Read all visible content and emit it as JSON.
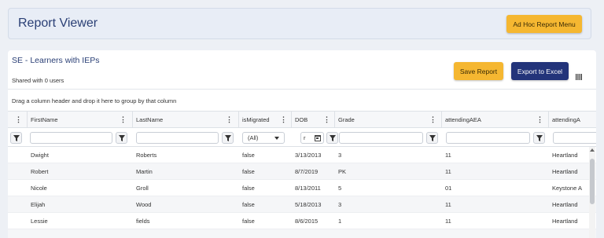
{
  "header": {
    "title": "Report Viewer",
    "adhoc_label": "Ad Hoc Report Menu"
  },
  "report": {
    "title": "SE - Learners with IEPs",
    "shared": "Shared with 0 users",
    "save_label": "Save Report",
    "export_label": "Export to Excel",
    "group_hint": "Drag a column header and drop it here to group by that column"
  },
  "grid": {
    "columns": [
      "FirstName",
      "LastName",
      "isMigrated",
      "DOB",
      "Grade",
      "attendingAEA",
      "attendingA"
    ],
    "filters": {
      "ismigrated_selected": "(All)",
      "dob_value": "r"
    },
    "rows": [
      {
        "first": "Dwight",
        "last": "Roberts",
        "migrated": "false",
        "dob": "3/13/2013",
        "grade": "3",
        "aea": "11",
        "attending": "Heartland"
      },
      {
        "first": "Robert",
        "last": "Martin",
        "migrated": "false",
        "dob": "8/7/2019",
        "grade": "PK",
        "aea": "11",
        "attending": "Heartland"
      },
      {
        "first": "Nicole",
        "last": "Groll",
        "migrated": "false",
        "dob": "8/13/2011",
        "grade": "5",
        "aea": "01",
        "attending": "Keystone A"
      },
      {
        "first": "Elijah",
        "last": "Wood",
        "migrated": "false",
        "dob": "5/18/2013",
        "grade": "3",
        "aea": "11",
        "attending": "Heartland"
      },
      {
        "first": "Lessie",
        "last": "fields",
        "migrated": "false",
        "dob": "8/6/2015",
        "grade": "1",
        "aea": "11",
        "attending": "Heartland"
      }
    ]
  },
  "colors": {
    "title": "#2a3f75",
    "yellow_button": "#f5b731",
    "navy_button": "#23347a"
  }
}
